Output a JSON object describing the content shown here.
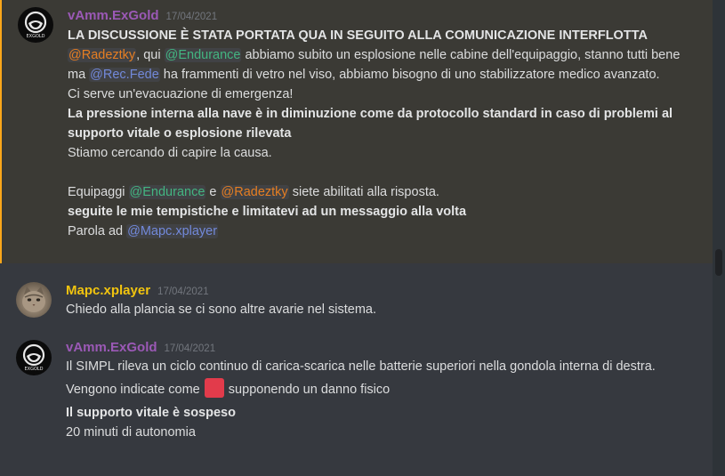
{
  "messages": [
    {
      "author": "vAmm.ExGold",
      "author_color": "#9b59b6",
      "timestamp": "17/04/2021",
      "avatar": "astronaut-helmet-avatar",
      "avatar_text": "EXGOLD",
      "highlighted": true,
      "lines": {
        "l1": "LA DISCUSSIONE È STATA PORTATA QUA IN SEGUITO ALLA COMUNICAZIONE INTERFLOTTA",
        "l2_m1": "@Radeztky",
        "l2_t1": ", qui ",
        "l2_m2": "@Endurance",
        "l2_t2": " abbiamo subito un esplosione nelle cabine dell'equipaggio, stanno tutti bene ma ",
        "l2_m3": "@Rec.Fede",
        "l2_t3": " ha frammenti di vetro nel viso, abbiamo bisogno di uno stabilizzatore medico avanzato.",
        "l3": "Ci serve un'evacuazione di emergenza!",
        "l4": "La pressione interna alla nave è in diminuzione come da protocollo standard in caso di problemi al supporto vitale o esplosione rilevata",
        "l5": "Stiamo cercando di capire la causa.",
        "l6_t1": "Equipaggi ",
        "l6_m1": "@Endurance",
        "l6_t2": " e ",
        "l6_m2": "@Radeztky",
        "l6_t3": " siete abilitati alla risposta.",
        "l7": "seguite le mie tempistiche e limitatevi ad un messaggio alla volta",
        "l8_t1": "Parola ad ",
        "l8_m1": "@Mapc.xplayer"
      }
    },
    {
      "author": "Mapc.xplayer",
      "author_color": "#f1c40f",
      "timestamp": "17/04/2021",
      "avatar": "cat-avatar",
      "lines": {
        "l1": "Chiedo alla plancia se ci sono altre avarie nel sistema."
      }
    },
    {
      "author": "vAmm.ExGold",
      "author_color": "#9b59b6",
      "timestamp": "17/04/2021",
      "avatar": "astronaut-helmet-avatar",
      "avatar_text": "EXGOLD",
      "lines": {
        "l1": "Il SIMPL rileva un ciclo continuo di carica-scarica nelle batterie superiori nella gondola interna di destra.",
        "l2_t1": "Vengono indicate come ",
        "l2_emoji": "red-square-emoji",
        "l2_t2": " supponendo un danno fisico",
        "l3": "Il supporto vitale è sospeso",
        "l4": "20 minuti di autonomia"
      }
    }
  ],
  "colors": {
    "background": "#36393f",
    "highlight_bg": "#3b3a35",
    "highlight_border": "#faa61a",
    "mention_green": "#43b581",
    "mention_orange": "#e67e22",
    "mention_blue": "#7289da"
  }
}
